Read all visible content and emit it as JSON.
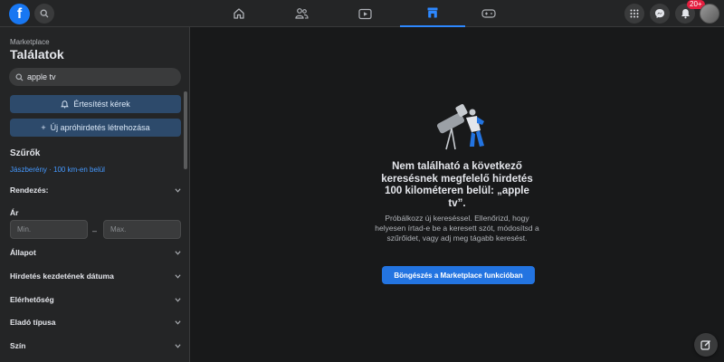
{
  "topbar": {
    "logo_letter": "f",
    "nav": [
      {
        "name": "home",
        "icon": "home-icon"
      },
      {
        "name": "friends",
        "icon": "friends-icon"
      },
      {
        "name": "watch",
        "icon": "video-icon"
      },
      {
        "name": "marketplace",
        "icon": "marketplace-icon",
        "active": true
      },
      {
        "name": "gaming",
        "icon": "gamepad-icon"
      }
    ],
    "notification_badge": "20+"
  },
  "sidebar": {
    "breadcrumb": "Marketplace",
    "title": "Találatok",
    "search_value": "apple tv",
    "notify_button": "Értesítést kérek",
    "create_listing_button": "Új apróhirdetés létrehozása",
    "filters_heading": "Szűrők",
    "location": "Jászberény · 100 km-en belül",
    "sort_label": "Rendezés:",
    "price_label": "Ár",
    "price_min_placeholder": "Min.",
    "price_max_placeholder": "Max.",
    "price_dash": "–",
    "filters": [
      "Állapot",
      "Hirdetés kezdetének dátuma",
      "Elérhetőség",
      "Eladó típusa",
      "Szín"
    ]
  },
  "main": {
    "empty_title": "Nem található a következő keresésnek megfelelő hirdetés 100 kilométeren belül: „apple tv”.",
    "empty_subtitle": "Próbálkozz új kereséssel. Ellenőrizd, hogy helyesen írtad-e be a keresett szót, módosítsd a szűrőidet, vagy adj meg tágabb keresést.",
    "browse_button": "Böngészés a Marketplace funkcióban"
  },
  "colors": {
    "accent": "#2374e1",
    "link": "#4599ff",
    "background": "#18191a",
    "panel": "#242526"
  }
}
